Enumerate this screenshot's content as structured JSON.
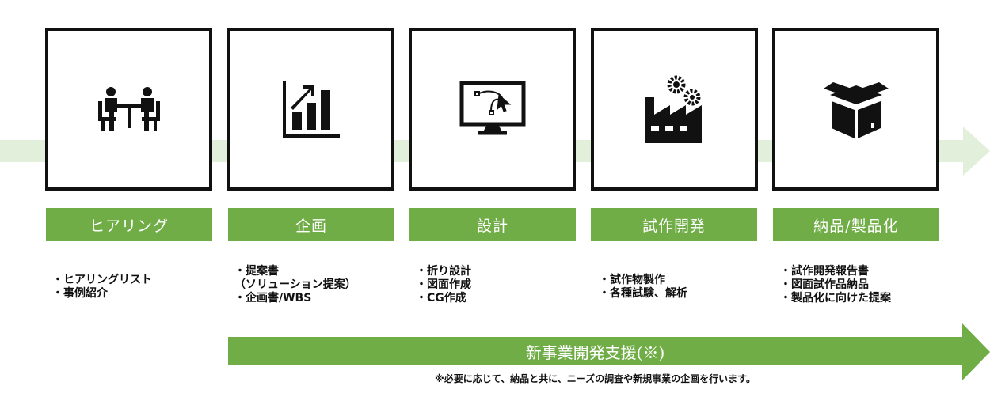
{
  "steps": [
    {
      "title": "ヒアリング",
      "icon": "meeting-icon",
      "items": [
        "・ヒアリングリスト",
        "・事例紹介"
      ]
    },
    {
      "title": "企画",
      "icon": "growth-chart-icon",
      "items": [
        "・提案書",
        "（ソリューション提案）",
        "・企画書/WBS"
      ]
    },
    {
      "title": "設計",
      "icon": "design-monitor-icon",
      "items": [
        "・折り設計",
        "・図面作成",
        "・CG作成"
      ]
    },
    {
      "title": "試作開発",
      "icon": "factory-icon",
      "items": [
        "・試作物製作",
        "・各種試験、解析"
      ]
    },
    {
      "title": "納品/製品化",
      "icon": "package-icon",
      "items": [
        "・試作開発報告書",
        "・図面試作品納品",
        "・製品化に向けた提案"
      ]
    }
  ],
  "support": {
    "title": "新事業開発支援(※)",
    "note": "※必要に応じて、納品と共に、ニーズの調査や新規事業の企画を行います。"
  },
  "colors": {
    "accent": "#70ad47",
    "flow": "#e2efda"
  }
}
